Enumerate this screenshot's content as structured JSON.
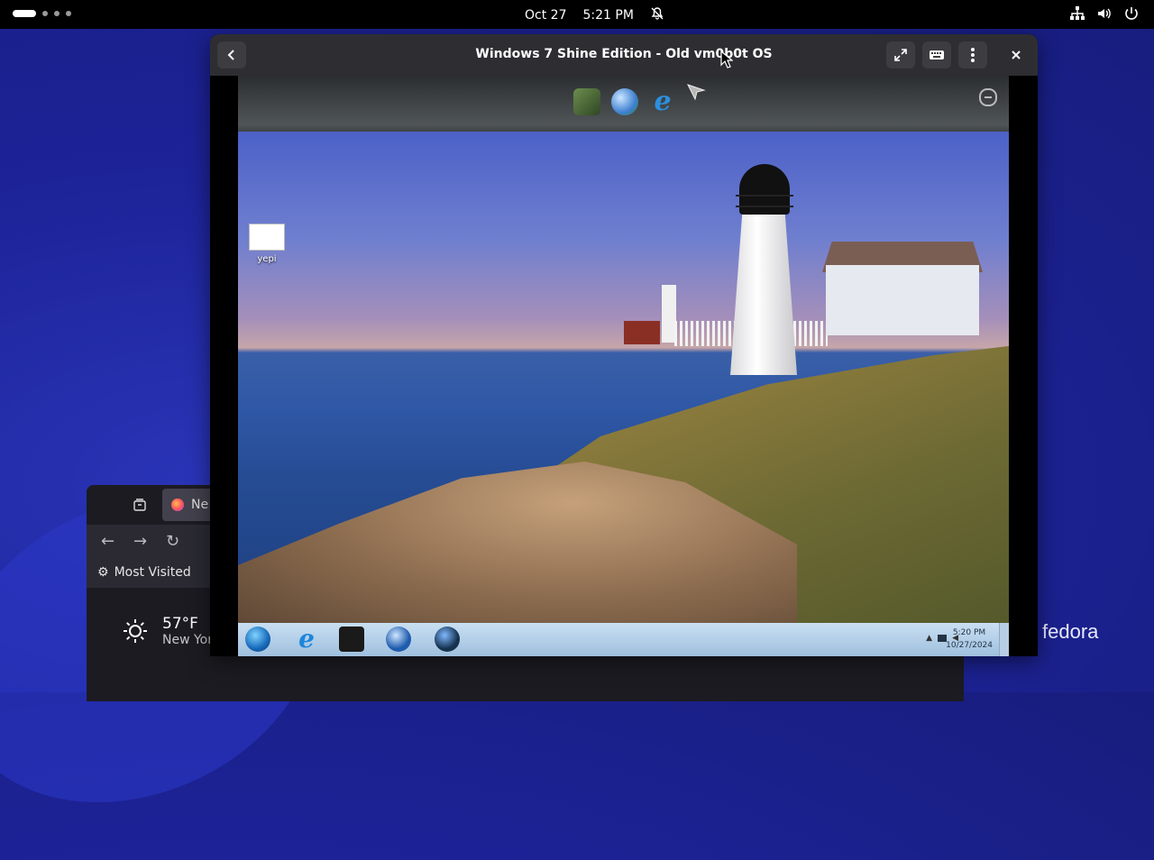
{
  "topbar": {
    "date": "Oct 27",
    "time": "5:21 PM",
    "icons": [
      "notifications-off-icon",
      "network-icon",
      "volume-icon",
      "power-icon"
    ]
  },
  "wallpaper": {
    "brand": "fedora"
  },
  "firefox": {
    "tab_title": "Ne",
    "bookmarks_label": "Most Visited",
    "weather": {
      "temp": "57°F",
      "city": "New Yor"
    }
  },
  "vm_window": {
    "title": "Windows 7 Shine Edition - Old vm0b0t OS",
    "buttons": [
      "back-button",
      "fullscreen-button",
      "keyboard-button",
      "menu-button",
      "close-button"
    ]
  },
  "guest": {
    "desktop_icon_label": "yepi",
    "clock_time": "5:20 PM",
    "clock_date": "10/27/2024",
    "dock_icons": [
      "app-icon",
      "network-globe-icon",
      "internet-explorer-icon"
    ]
  },
  "colors": {
    "topbar_bg": "#000000",
    "header_bg": "#2e2e32",
    "accent": "#1f86db"
  }
}
